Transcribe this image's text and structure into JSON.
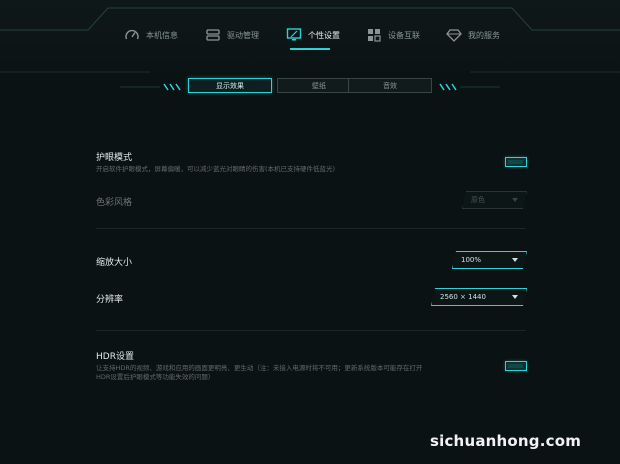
{
  "nav": {
    "items": [
      {
        "label": "本机信息",
        "icon": "gauge-icon"
      },
      {
        "label": "驱动管理",
        "icon": "driver-icon"
      },
      {
        "label": "个性设置",
        "icon": "monitor-icon",
        "active": true
      },
      {
        "label": "设备互联",
        "icon": "grid-icon"
      },
      {
        "label": "我的服务",
        "icon": "diamond-icon"
      }
    ]
  },
  "tabs": [
    {
      "label": "显示效果",
      "active": true
    },
    {
      "label": "壁纸"
    },
    {
      "label": "音效"
    }
  ],
  "eye_care": {
    "title": "护眼模式",
    "description": "开启软件护眼模式，屏幕偏暖，可以减少蓝光对眼睛的伤害(本机已支持硬件低蓝光)"
  },
  "color_style": {
    "label": "色彩风格",
    "value": "原色"
  },
  "scale": {
    "label": "缩放大小",
    "value": "100%"
  },
  "resolution": {
    "label": "分辨率",
    "value": "2560 × 1440"
  },
  "hdr": {
    "title": "HDR设置",
    "description_line1": "让支持HDR的视频、游戏和应用的画面更明亮、更生动（注：未接入电源时将不可用；更新系统版本可能存在打开",
    "description_line2": "HDR设置后护眼模式等功能失效的问题）"
  },
  "watermark": "sichuanhong.com",
  "colors": {
    "accent": "#2fd3d6",
    "background": "#0b1213"
  }
}
